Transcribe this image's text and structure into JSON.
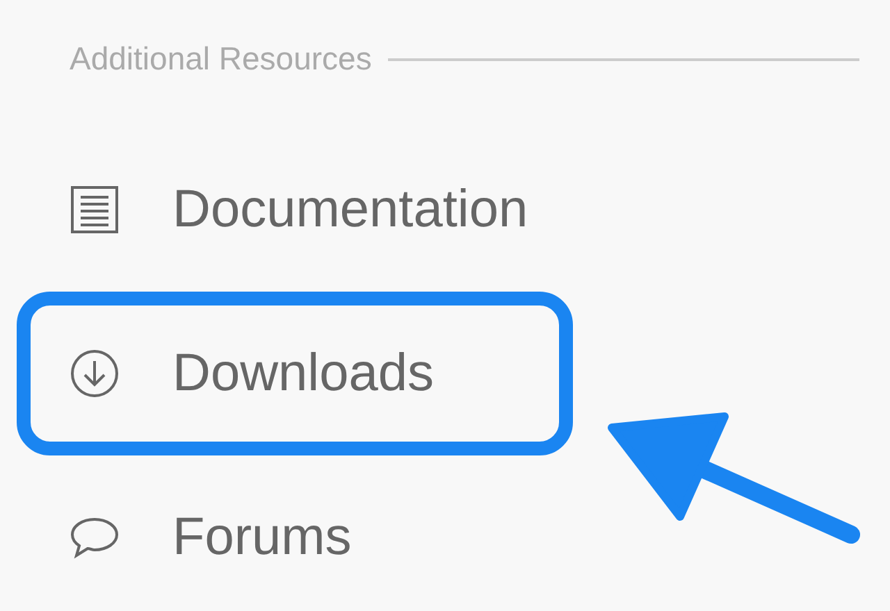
{
  "section": {
    "title": "Additional Resources"
  },
  "items": [
    {
      "kind": "document",
      "label": "Documentation",
      "highlighted": false
    },
    {
      "kind": "download",
      "label": "Downloads",
      "highlighted": true
    },
    {
      "kind": "chat",
      "label": "Forums",
      "highlighted": false
    }
  ]
}
